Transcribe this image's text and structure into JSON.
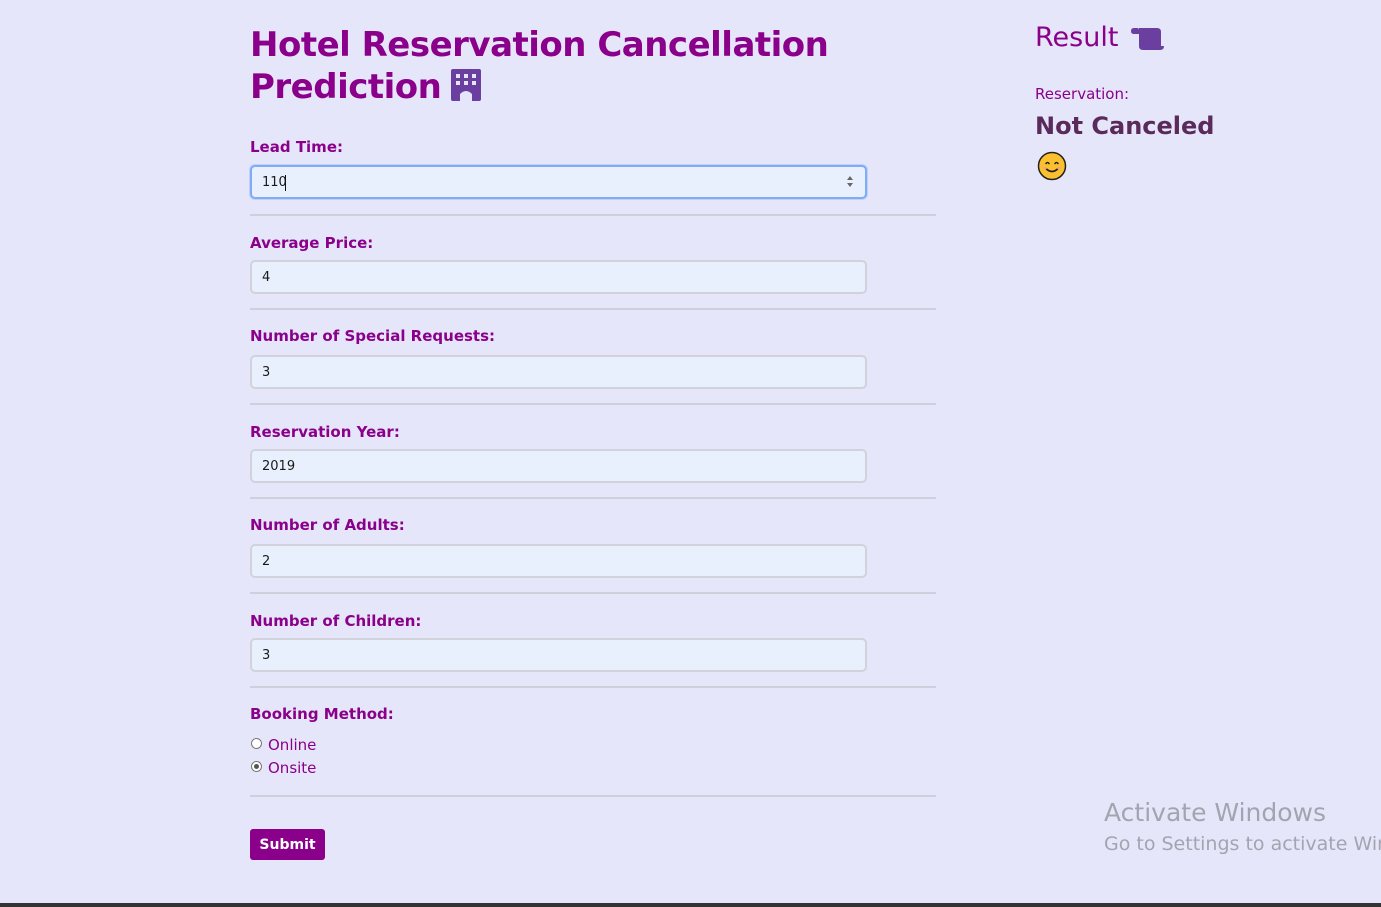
{
  "header": {
    "title": "Hotel Reservation Cancellation Prediction",
    "title_icon": "hotel-building-icon"
  },
  "form": {
    "lead_time": {
      "label": "Lead Time:",
      "value": "110"
    },
    "average_price": {
      "label": "Average Price:",
      "value": "4"
    },
    "special_requests": {
      "label": "Number of Special Requests:",
      "value": "3"
    },
    "reservation_year": {
      "label": "Reservation Year:",
      "value": "2019"
    },
    "adults": {
      "label": "Number of Adults:",
      "value": "2"
    },
    "children": {
      "label": "Number of Children:",
      "value": "3"
    },
    "booking_method": {
      "label": "Booking Method:",
      "options": [
        "Online",
        "Onsite"
      ],
      "selected": "Onsite"
    },
    "submit_label": "Submit"
  },
  "result": {
    "title": "Result",
    "title_icon": "scroll-icon",
    "label": "Reservation:",
    "value": "Not Canceled",
    "emoji_icon": "smiling-face-icon"
  },
  "watermark": {
    "line1": "Activate Windows",
    "line2": "Go to Settings to activate Windows."
  },
  "colors": {
    "background": "#e6e6fa",
    "accent": "#8b008b",
    "result_value": "#5a2a5a",
    "input_bg": "#e8f0fe"
  }
}
